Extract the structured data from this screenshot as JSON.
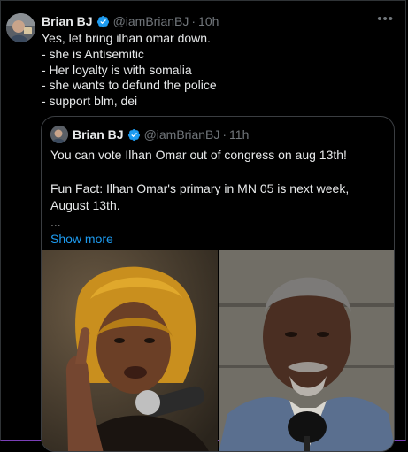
{
  "tweet": {
    "author_name": "Brian BJ",
    "handle": "@iamBrianBJ",
    "separator": "·",
    "time": "10h",
    "more_icon": "more-dots-icon",
    "lines": [
      "Yes, let bring ilhan omar down.",
      "- she is Antisemitic",
      "- Her loyalty is with somalia",
      "- she wants to defund the police",
      "- support blm, dei"
    ]
  },
  "quote": {
    "author_name": "Brian BJ",
    "handle": "@iamBrianBJ",
    "separator": "·",
    "time": "11h",
    "line1": "You can vote Ilhan Omar out of congress on aug 13th!",
    "line2": "Fun Fact: Ilhan Omar's primary in MN 05 is next week, August 13th.",
    "ellipsis": "...",
    "show_more": "Show more"
  },
  "colors": {
    "background": "#000000",
    "text": "#e7e9ea",
    "secondary": "#71767b",
    "accent": "#1d9bf0",
    "border": "#2f3336"
  }
}
